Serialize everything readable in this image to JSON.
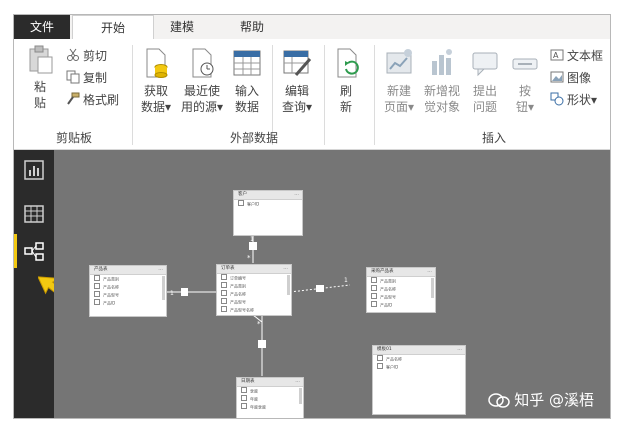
{
  "tabs": [
    "文件",
    "开始",
    "建模",
    "帮助"
  ],
  "ribbon": {
    "clipboard": {
      "paste": [
        "粘",
        "贴"
      ],
      "cut": "剪切",
      "copy": "复制",
      "format_painter": "格式刷",
      "label": "剪贴板"
    },
    "external_data": {
      "get_data": [
        "获取",
        "数据▾"
      ],
      "recent_sources": [
        "最近使",
        "用的源▾"
      ],
      "enter_data": [
        "输入",
        "数据"
      ],
      "edit_queries": [
        "编辑",
        "查询▾"
      ],
      "refresh": [
        "刷",
        "新"
      ],
      "label": "外部数据"
    },
    "insert": {
      "new_page": [
        "新建",
        "页面▾"
      ],
      "new_visual": [
        "新增视",
        "觉对象"
      ],
      "ask_question": [
        "提出",
        "问题"
      ],
      "button": [
        "按",
        "钮▾"
      ],
      "text_box": "文本框",
      "image": "图像",
      "shapes": "形状▾",
      "label": "插入"
    }
  },
  "model": {
    "customer": {
      "title": "客户",
      "fields": [
        "客户ID"
      ]
    },
    "product": {
      "title": "产品表",
      "fields": [
        "产品类别",
        "产品名称",
        "产品型号",
        "产品ID"
      ]
    },
    "orders": {
      "title": "订单表",
      "fields": [
        "订单编号",
        "产品类别",
        "产品名称",
        "产品型号",
        "产品型号名称"
      ]
    },
    "sales_product": {
      "title": "采购产品表",
      "fields": [
        "产品类别",
        "产品名称",
        "产品型号",
        "产品ID"
      ]
    },
    "dates": {
      "title": "日期表",
      "fields": [
        "季度",
        "年度",
        "年度季度"
      ]
    },
    "template": {
      "title": "模板01",
      "fields": [
        "产品名称",
        "客户ID"
      ]
    },
    "rel_one": "1",
    "rel_many": "*"
  },
  "watermark": "知乎 @溪梧"
}
